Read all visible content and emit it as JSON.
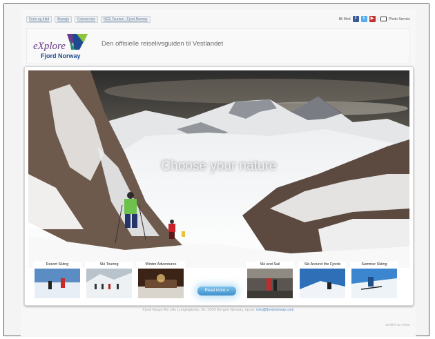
{
  "topnav": {
    "links": [
      "Ferie og fritid",
      "Bransje",
      "Fotoservice",
      "NCE Tourism - Fjord Norway"
    ]
  },
  "topright": {
    "share_label": "Bli Med",
    "photo_service": "Photo Service",
    "icons": [
      "facebook-icon",
      "twitter-icon",
      "youtube-icon",
      "photo-icon"
    ]
  },
  "header": {
    "logo_text_1": "eXplore",
    "logo_text_2": "Fjord Norway",
    "tagline": "Den offisielle reiselivsguiden til Vestlandet"
  },
  "hero": {
    "title": "Choose your nature"
  },
  "tiles": [
    {
      "label": "Resort Skiing"
    },
    {
      "label": "Ski Touring"
    },
    {
      "label": "Winter Adventures"
    },
    {
      "label": "Ski and Sail"
    },
    {
      "label": "Ski Around the Fjords"
    },
    {
      "label": "Summer Skiing"
    }
  ],
  "read_more": "Read more »",
  "footer": {
    "address": "Fjord Norge AS Lille Lungegårdsv. 2b, 5003 Bergen Norway, epost:",
    "email": "info@fjordnorway.com"
  },
  "credit": "utviklet av reklor",
  "colors": {
    "accent_blue": "#4e86c7",
    "logo_purple": "#6b3b8c",
    "logo_green": "#8cc63f",
    "logo_blue": "#1e4b8f"
  }
}
